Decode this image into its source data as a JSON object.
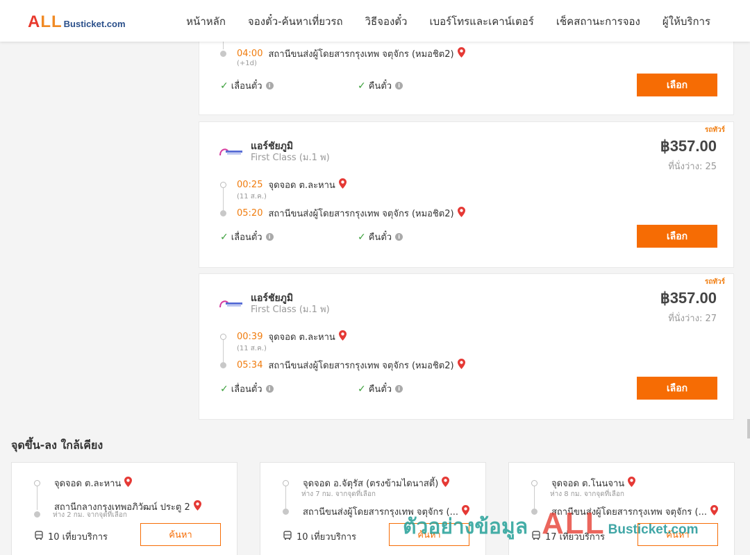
{
  "header": {
    "logo_all": "ALL",
    "logo_rest": "Busticket.com",
    "nav": [
      "หน้าหลัก",
      "จองตั๋ว-ค้นหาเที่ยวรถ",
      "วิธีจองตั๋ว",
      "เบอร์โทรและเคาน์เตอร์",
      "เช็คสถานะการจอง",
      "ผู้ให้บริการ"
    ]
  },
  "partial_trip": {
    "arrive_time": "04:00",
    "arrive_place": "สถานีขนส่งผู้โดยสารกรุงเทพ จตุจักร (หมอชิต2)",
    "arrive_note": "(+1d)",
    "reschedule_label": "เลื่อนตั๋ว",
    "refund_label": "คืนตั๋ว",
    "select_label": "เลือก"
  },
  "trips": [
    {
      "tag": "รถทัวร์",
      "operator": "แอร์ชัยภูมิ",
      "class": "First Class (ม.1 พ)",
      "price": "฿357.00",
      "seats": "ที่นั่งว่าง: 25",
      "depart_time": "00:25",
      "depart_place": "จุดจอด ต.ละหาน",
      "depart_date": "(11 ส.ค.)",
      "arrive_time": "05:20",
      "arrive_place": "สถานีขนส่งผู้โดยสารกรุงเทพ จตุจักร (หมอชิต2)",
      "reschedule_label": "เลื่อนตั๋ว",
      "refund_label": "คืนตั๋ว",
      "select_label": "เลือก"
    },
    {
      "tag": "รถทัวร์",
      "operator": "แอร์ชัยภูมิ",
      "class": "First Class (ม.1 พ)",
      "price": "฿357.00",
      "seats": "ที่นั่งว่าง: 27",
      "depart_time": "00:39",
      "depart_place": "จุดจอด ต.ละหาน",
      "depart_date": "(11 ส.ค.)",
      "arrive_time": "05:34",
      "arrive_place": "สถานีขนส่งผู้โดยสารกรุงเทพ จตุจักร (หมอชิต2)",
      "reschedule_label": "เลื่อนตั๋ว",
      "refund_label": "คืนตั๋ว",
      "select_label": "เลือก"
    }
  ],
  "nearby": {
    "title": "จุดขึ้น-ลง ใกล้เคียง",
    "cards": [
      {
        "from": "จุดจอด ต.ละหาน",
        "from_note": "",
        "to": "สถานีกลางกรุงเทพอภิวัฒน์ ประตู 2",
        "to_note": "ห่าง 2 กม. จากจุดที่เลือก",
        "rides": "10 เที่ยวบริการ",
        "search_label": "ค้นหา"
      },
      {
        "from": "จุดจอด อ.จัตุรัส (ตรงข้ามไดนาสตี้)",
        "from_note": "ห่าง 7 กม. จากจุดที่เลือก",
        "to": "สถานีขนส่งผู้โดยสารกรุงเทพ จตุจักร (...",
        "to_note": "",
        "rides": "10 เที่ยวบริการ",
        "search_label": "ค้นหา"
      },
      {
        "from": "จุดจอด ต.โนนจาน",
        "from_note": "ห่าง 8 กม. จากจุดที่เลือก",
        "to": "สถานีขนส่งผู้โดยสารกรุงเทพ จตุจักร (...",
        "to_note": "",
        "rides": "17 เที่ยวบริการ",
        "search_label": "ค้นหา"
      }
    ]
  },
  "watermark": {
    "text": "ตัวอย่างข้อมูล",
    "all": "ALL",
    "rest": "Busticket.com"
  },
  "colors": {
    "accent": "#f66c04",
    "time": "#f07c0e",
    "check": "#3a9f3a",
    "pin": "#e53935"
  }
}
